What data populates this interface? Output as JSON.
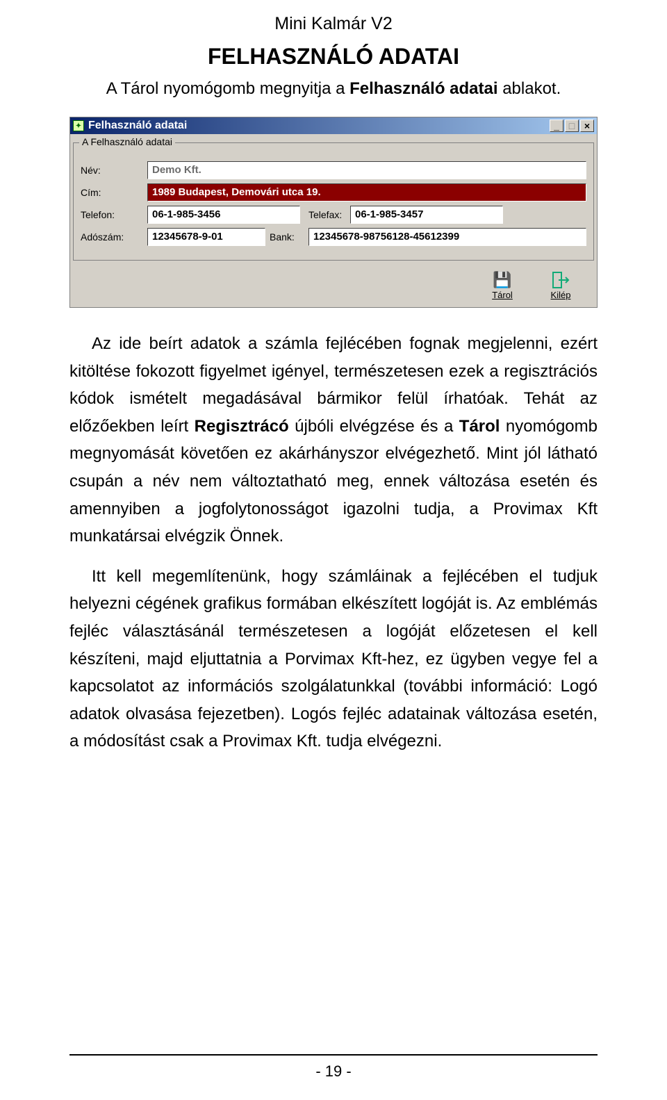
{
  "doc": {
    "header": "Mini Kalmár V2",
    "title": "FELHASZNÁLÓ ADATAI",
    "subtitle_prefix": "A Tárol nyomógomb megnyitja a ",
    "subtitle_bold": "Felhasználó adatai",
    "subtitle_suffix": " ablakot.",
    "page_number": "- 19 -"
  },
  "window": {
    "title": "Felhasználó adatai",
    "group_label": "A Felhasználó adatai",
    "labels": {
      "nev": "Név:",
      "cim": "Cím:",
      "telefon": "Telefon:",
      "telefax": "Telefax:",
      "adoszam": "Adószám:",
      "bank": "Bank:"
    },
    "values": {
      "nev": "Demo Kft.",
      "cim": "1989 Budapest, Demovári utca 19.",
      "telefon": "06-1-985-3456",
      "telefax": "06-1-985-3457",
      "adoszam": "12345678-9-01",
      "bank": "12345678-98756128-45612399"
    },
    "buttons": {
      "tarol": "Tárol",
      "kilep": "Kilép"
    },
    "win_controls": {
      "min": "_",
      "max": "□",
      "close": "×"
    }
  },
  "paragraphs": {
    "p1_a": "Az ide beírt adatok a számla fejlécében fognak megjelenni, ezért kitöltése fokozott figyelmet igényel, természetesen ezek a regisztrációs kódok ismételt megadásával bármikor felül írhatóak. Tehát az előzőekben leírt ",
    "p1_b1": "Regisztrácó",
    "p1_c": " újbóli elvégzése és a ",
    "p1_b2": "Tárol",
    "p1_d": " nyomógomb megnyomását követően ez akárhányszor elvégezhető. Mint jól látható csupán a név nem változtatható meg, ennek változása esetén és amennyiben a jogfolytonosságot igazolni tudja, a Provimax Kft munkatársai elvégzik Önnek.",
    "p2": "Itt kell megemlítenünk, hogy számláinak a fejlécében el tudjuk helyezni cégének grafikus formában elkészített logóját is. Az emblémás fejléc választásánál természetesen a logóját előzetesen el kell készíteni, majd eljuttatnia a Porvimax Kft-hez, ez ügyben vegye fel a kapcsolatot az információs szolgálatunkkal (további információ: Logó adatok olvasása fejezetben). Logós fejléc adatainak változása esetén, a módosítást csak a Provimax Kft. tudja elvégezni."
  }
}
